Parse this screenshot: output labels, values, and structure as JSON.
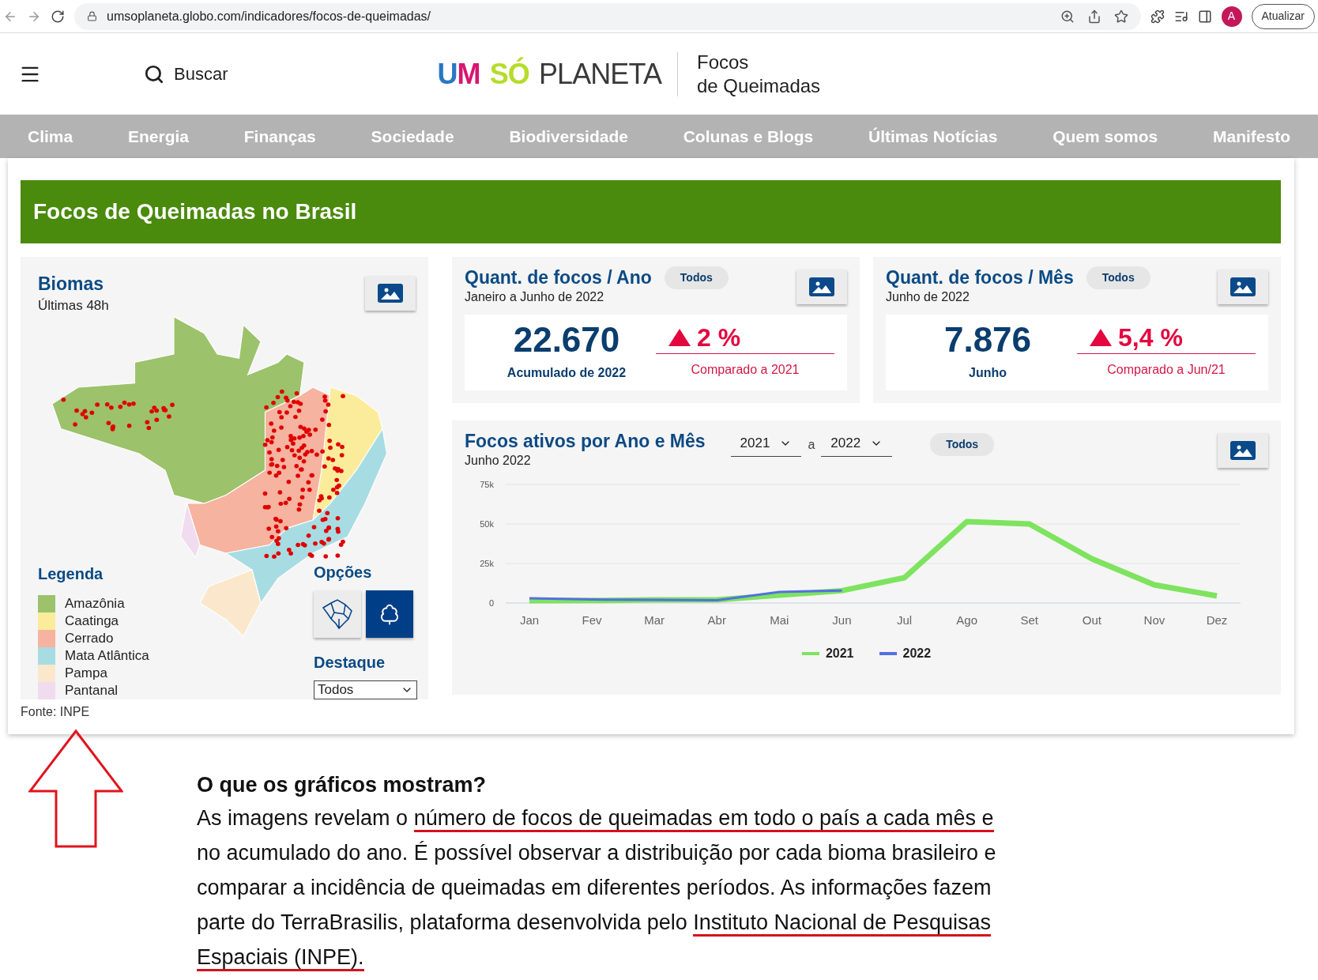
{
  "browser": {
    "url": "umsoplaneta.globo.com/indicadores/focos-de-queimadas/",
    "avatar": "A",
    "update_button": "Atualizar"
  },
  "header": {
    "search": "Buscar",
    "logo": [
      {
        "text": "U",
        "color": "#2a77c4"
      },
      {
        "text": "M",
        "color": "#d6166f"
      },
      {
        "text": "SÓ",
        "color": "#b5dc2a"
      },
      {
        "text": "PLANETA",
        "color": "#3a3a3a"
      }
    ],
    "site_title": [
      "Focos",
      "de Queimadas"
    ]
  },
  "nav": [
    "Clima",
    "Energia",
    "Finanças",
    "Sociedade",
    "Biodiversidade",
    "Colunas e Blogs",
    "Últimas Notícias",
    "Quem somos",
    "Manifesto"
  ],
  "page_title": "Focos de Queimadas no Brasil",
  "biomes_panel": {
    "title": "Biomas",
    "subtitle": "Últimas 48h",
    "legend_title": "Legenda",
    "legend": [
      {
        "label": "Amazônia",
        "color": "#9cc26b"
      },
      {
        "label": "Caatinga",
        "color": "#fbec9c"
      },
      {
        "label": "Cerrado",
        "color": "#f5b3a0"
      },
      {
        "label": "Mata Atlântica",
        "color": "#a8dce3"
      },
      {
        "label": "Pampa",
        "color": "#fbe8cc"
      },
      {
        "label": "Pantanal",
        "color": "#f0dcee"
      }
    ],
    "options_title": "Opções",
    "options": [
      {
        "kind": "states",
        "selected": false
      },
      {
        "kind": "biomes",
        "selected": true
      }
    ],
    "highlight_title": "Destaque",
    "highlight_value": "Todos"
  },
  "source": "Fonte: INPE",
  "stats": [
    {
      "title": "Quant. de focos / Ano",
      "filter": "Todos",
      "subtitle": "Janeiro a Junho de 2022",
      "value": "22.670",
      "value_label": "Acumulado de 2022",
      "kind": "increase",
      "change": "2 %",
      "comparison": "Comparado a 2021"
    },
    {
      "title": "Quant. de focos / Mês",
      "filter": "Todos",
      "subtitle": "Junho de 2022",
      "value": "7.876",
      "value_label": "Junho",
      "kind": "increase",
      "change": "5,4 %",
      "comparison": "Comparado a Jun/21"
    }
  ],
  "monthly": {
    "title": "Focos ativos por Ano e Mês",
    "subtitle": "Junho 2022",
    "from": "2021",
    "between": "a",
    "to": "2022",
    "filter": "Todos",
    "chart_data": {
      "type": "line",
      "categories": [
        "Jan",
        "Fev",
        "Mar",
        "Abr",
        "Mai",
        "Jun",
        "Jul",
        "Ago",
        "Set",
        "Out",
        "Nov",
        "Dez"
      ],
      "series": [
        {
          "name": "2021",
          "color": "#7ee35f",
          "values": [
            1500,
            1600,
            2000,
            2000,
            5000,
            7800,
            16000,
            51500,
            50000,
            28000,
            11500,
            4500
          ]
        },
        {
          "name": "2022",
          "color": "#5470e0",
          "values": [
            3000,
            2200,
            2000,
            1800,
            7000,
            7900,
            null,
            null,
            null,
            null,
            null,
            null
          ]
        }
      ],
      "legend": "bottom",
      "ylim": [
        0,
        75000
      ],
      "yticks": [
        {
          "value": 0,
          "label": "0"
        },
        {
          "value": 25000,
          "label": "25k"
        },
        {
          "value": 50000,
          "label": "50k"
        },
        {
          "value": 75000,
          "label": "75k"
        }
      ]
    }
  },
  "article": {
    "heading": "O que os gráficos mostram?",
    "paragraph": [
      {
        "text": "As imagens revelam o ",
        "underlined": false
      },
      {
        "text": "número de focos de queimadas em todo o país a cada mês e",
        "underlined": true
      },
      {
        "text": " no acumulado do ano. É possível observar a distribuição por cada bioma brasileiro e comparar a incidência de queimadas em diferentes períodos. As informações fazem parte do TerraBrasilis, plataforma desenvolvida pelo ",
        "underlined": false
      },
      {
        "text": "Instituto Nacional de Pesquisas Espaciais (INPE).",
        "underlined": true
      }
    ]
  }
}
